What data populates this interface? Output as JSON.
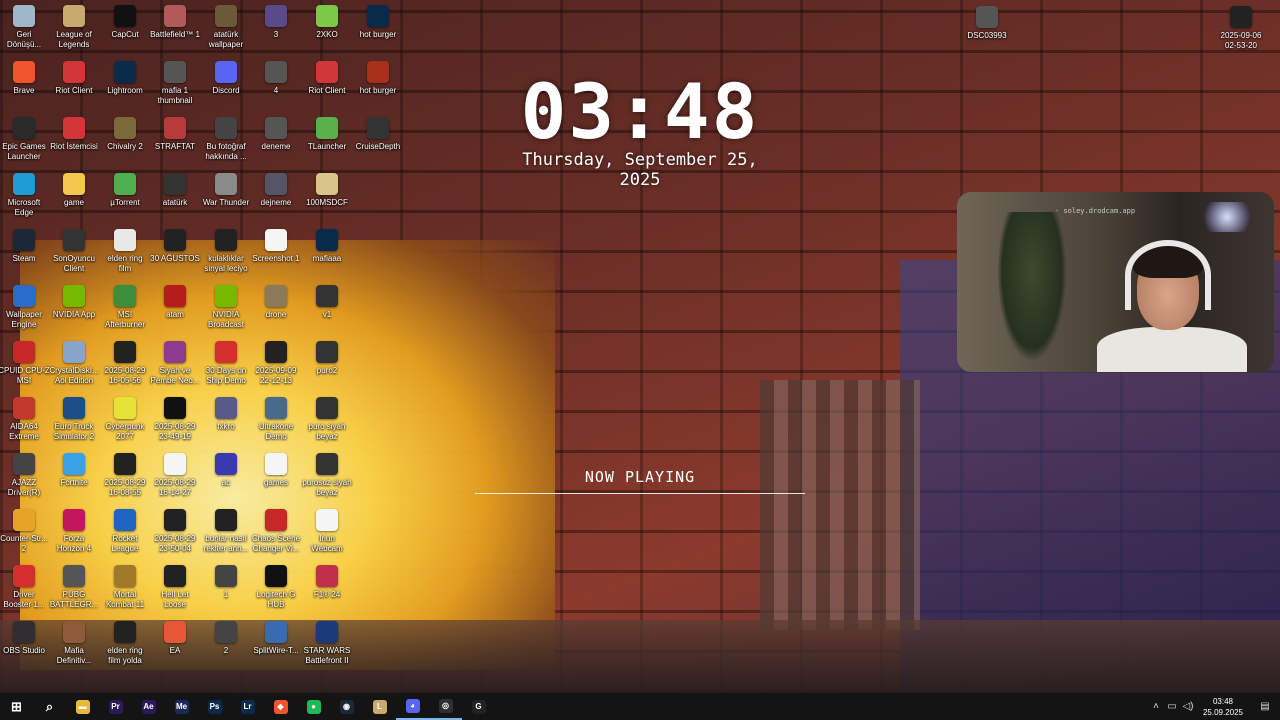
{
  "clock": {
    "time": "03:48",
    "date": "Thursday, September 25, 2025"
  },
  "now_playing": {
    "label": "NOW PLAYING"
  },
  "webcam": {
    "url_text": "· soley.drodcam.app"
  },
  "top_right_files": [
    {
      "label": "DSC03993"
    },
    {
      "label": "2025-09-06\n02-53-20"
    }
  ],
  "desktop_columns": [
    [
      {
        "label": "Geri\nDönüşü...",
        "icon": "recycle-bin-icon",
        "color": "#9fb7c9"
      },
      {
        "label": "Brave",
        "icon": "brave-icon",
        "color": "#f0542d"
      },
      {
        "label": "Epic Games\nLauncher",
        "icon": "epic-icon",
        "color": "#2a2a2a"
      },
      {
        "label": "Microsoft\nEdge",
        "icon": "edge-icon",
        "color": "#1f9bd6"
      },
      {
        "label": "Steam",
        "icon": "steam-icon",
        "color": "#1b2838"
      },
      {
        "label": "Wallpaper\nEngine",
        "icon": "wallpaper-engine-icon",
        "color": "#2a6cc9"
      },
      {
        "label": "CPUID CPU-Z\nMSI",
        "icon": "cpuz-icon",
        "color": "#c62828"
      },
      {
        "label": "AIDA64\nExtreme",
        "icon": "aida-icon",
        "color": "#c0392b"
      },
      {
        "label": "AJAZZ\nDriver(R)",
        "icon": "ajazz-icon",
        "color": "#444"
      },
      {
        "label": "Counter-Str...\n2",
        "icon": "cs2-icon",
        "color": "#e7a325"
      },
      {
        "label": "Driver\nBooster 1...",
        "icon": "driver-booster-icon",
        "color": "#d32f2f"
      },
      {
        "label": "OBS Studio",
        "icon": "obs-icon",
        "color": "#302e31"
      }
    ],
    [
      {
        "label": "League of\nLegends",
        "icon": "lol-icon",
        "color": "#c8aa6e"
      },
      {
        "label": "Riot Client",
        "icon": "riot-icon",
        "color": "#d13639"
      },
      {
        "label": "Riot İstemcisi",
        "icon": "riot-icon",
        "color": "#d13639"
      },
      {
        "label": "game",
        "icon": "folder-icon",
        "color": "#f3c74d"
      },
      {
        "label": "SonOyuncu\nClient",
        "icon": "sonoyuncu-icon",
        "color": "#333"
      },
      {
        "label": "NVIDIA App",
        "icon": "nvidia-icon",
        "color": "#76b900"
      },
      {
        "label": "CrystalDiskI...\nAoi Edition",
        "icon": "crystaldisk-icon",
        "color": "#8aa3c9"
      },
      {
        "label": "Euro Truck\nSimulator 2",
        "icon": "ets2-icon",
        "color": "#1d4e89"
      },
      {
        "label": "Fortnite",
        "icon": "fortnite-icon",
        "color": "#3aa0e8"
      },
      {
        "label": "Forza\nHorizon 4",
        "icon": "forza-icon",
        "color": "#c2185b"
      },
      {
        "label": "PUBG\nBATTLEGR...",
        "icon": "pubg-icon",
        "color": "#555"
      },
      {
        "label": "Mafia\nDefinitiv...",
        "icon": "mafia-icon",
        "color": "#8d5a3a"
      }
    ],
    [
      {
        "label": "CapCut",
        "icon": "capcut-icon",
        "color": "#111"
      },
      {
        "label": "Lightroom",
        "icon": "lightroom-icon",
        "color": "#0b2b4a"
      },
      {
        "label": "Chivalry 2",
        "icon": "chivalry-icon",
        "color": "#7a6a3a"
      },
      {
        "label": "µTorrent",
        "icon": "utorrent-icon",
        "color": "#4caf50"
      },
      {
        "label": "elden ring\nfilm",
        "icon": "document-icon",
        "color": "#e8e8e8"
      },
      {
        "label": "MSI\nAfterburner",
        "icon": "msi-icon",
        "color": "#3c8f3a"
      },
      {
        "label": "2025-08-29\n16-05-56",
        "icon": "video-file-icon",
        "color": "#222"
      },
      {
        "label": "Cyberpunk\n2077",
        "icon": "cyberpunk-icon",
        "color": "#e5e23a"
      },
      {
        "label": "2025-08-29\n16-08-55",
        "icon": "video-file-icon",
        "color": "#222"
      },
      {
        "label": "Rocket\nLeague",
        "icon": "rocket-league-icon",
        "color": "#2064c2"
      },
      {
        "label": "Mortal\nKombat 11",
        "icon": "mk-icon",
        "color": "#a07a2a"
      },
      {
        "label": "elden ring\nfilm yolda",
        "icon": "video-file-icon",
        "color": "#222"
      }
    ],
    [
      {
        "label": "Battlefield™ 1",
        "icon": "battlefield-icon",
        "color": "#b05a5a"
      },
      {
        "label": "mafia 1\nthumbnail",
        "icon": "image-file-icon",
        "color": "#555"
      },
      {
        "label": "STRAFTAT",
        "icon": "straftat-icon",
        "color": "#b83a3a"
      },
      {
        "label": "atatürk",
        "icon": "image-file-icon",
        "color": "#333"
      },
      {
        "label": "30 AĞUSTOS",
        "icon": "video-file-icon",
        "color": "#222"
      },
      {
        "label": "atam",
        "icon": "image-file-icon",
        "color": "#b71c1c"
      },
      {
        "label": "Siyah ve\nPembe Neo...",
        "icon": "image-file-icon",
        "color": "#8e3a8e"
      },
      {
        "label": "2025-08-29\n23-49-19",
        "icon": "video-file-icon",
        "color": "#111"
      },
      {
        "label": "2025-08-29\n16-14-27",
        "icon": "video-file-icon",
        "color": "#f5f5f5"
      },
      {
        "label": "2025-08-29\n23-50-04",
        "icon": "video-file-icon",
        "color": "#222"
      },
      {
        "label": "Hell Let\nLoose",
        "icon": "hll-icon",
        "color": "#222"
      },
      {
        "label": "EA",
        "icon": "ea-icon",
        "color": "#e8563a"
      }
    ],
    [
      {
        "label": "atatürk\nwallpaper",
        "icon": "image-file-icon",
        "color": "#6a5a3a"
      },
      {
        "label": "Discord",
        "icon": "discord-icon",
        "color": "#5865f2"
      },
      {
        "label": "Bu fotoğraf\nhakkında ...",
        "icon": "info-icon",
        "color": "#444"
      },
      {
        "label": "War Thunder",
        "icon": "war-thunder-icon",
        "color": "#8a8a8a"
      },
      {
        "label": "kulaklıklar\nsinyal leciyo",
        "icon": "video-file-icon",
        "color": "#222"
      },
      {
        "label": "NVIDIA\nBroadcast",
        "icon": "nvidia-broadcast-icon",
        "color": "#76b900"
      },
      {
        "label": "30 Days on\nShip Demo",
        "icon": "30days-icon",
        "color": "#d32f2f"
      },
      {
        "label": "fxkro",
        "icon": "image-file-icon",
        "color": "#5a5a8a"
      },
      {
        "label": "ac",
        "icon": "document-icon",
        "color": "#3a3ab0"
      },
      {
        "label": "bunlar nasıl\nreklter ann...",
        "icon": "video-file-icon",
        "color": "#222"
      },
      {
        "label": "1",
        "icon": "image-file-icon",
        "color": "#444"
      },
      {
        "label": "2",
        "icon": "image-file-icon",
        "color": "#444"
      }
    ],
    [
      {
        "label": "3",
        "icon": "image-file-icon",
        "color": "#5a4a8a"
      },
      {
        "label": "4",
        "icon": "image-file-icon",
        "color": "#555"
      },
      {
        "label": "deneme",
        "icon": "image-file-icon",
        "color": "#555"
      },
      {
        "label": "dejneme",
        "icon": "image-file-icon",
        "color": "#556"
      },
      {
        "label": "Screenshot 1",
        "icon": "document-icon",
        "color": "#f5f5f5"
      },
      {
        "label": "drone",
        "icon": "image-file-icon",
        "color": "#8a7a5a"
      },
      {
        "label": "2025-09-09\n22-12-13",
        "icon": "video-file-icon",
        "color": "#222"
      },
      {
        "label": "Ultrakone\nDemo",
        "icon": "ultrakone-icon",
        "color": "#4a6a8a"
      },
      {
        "label": "games",
        "icon": "document-icon",
        "color": "#f5f5f5"
      },
      {
        "label": "Chaos Scene\nChanger Vi...",
        "icon": "chaos-icon",
        "color": "#c62828"
      },
      {
        "label": "Logitech G\nHUB",
        "icon": "ghub-icon",
        "color": "#111"
      },
      {
        "label": "SplitWire-T...",
        "icon": "splitwire-icon",
        "color": "#3a6ab0"
      }
    ],
    [
      {
        "label": "2XKO",
        "icon": "2xko-icon",
        "color": "#7cc94a"
      },
      {
        "label": "Riot Client",
        "icon": "riot-icon",
        "color": "#d13639"
      },
      {
        "label": "TLauncher",
        "icon": "tlauncher-icon",
        "color": "#5ab04a"
      },
      {
        "label": "100MSDCF",
        "icon": "folder-icon",
        "color": "#d9c48a"
      },
      {
        "label": "mafiaaa",
        "icon": "photoshop-icon",
        "color": "#0a2a4a"
      },
      {
        "label": "v1",
        "icon": "image-file-icon",
        "color": "#333"
      },
      {
        "label": "puro2",
        "icon": "image-file-icon",
        "color": "#333"
      },
      {
        "label": "puro siyah\nbeyaz",
        "icon": "image-file-icon",
        "color": "#333"
      },
      {
        "label": "purosuz siyah\nbeyaz",
        "icon": "image-file-icon",
        "color": "#333"
      },
      {
        "label": "Iriun\nWebcam",
        "icon": "iriun-icon",
        "color": "#f5f5f5"
      },
      {
        "label": "F1® 24",
        "icon": "f1-icon",
        "color": "#c0304a"
      },
      {
        "label": "STAR WARS\nBattlefront II",
        "icon": "swbf-icon",
        "color": "#1a3a7a"
      }
    ],
    [
      {
        "label": "hot burger",
        "icon": "photoshop-icon",
        "color": "#0a2a4a"
      },
      {
        "label": "hot burger",
        "icon": "image-file-icon",
        "color": "#a8301a"
      },
      {
        "label": "CruiseDepth",
        "icon": "cruisedepth-icon",
        "color": "#333"
      }
    ]
  ],
  "taskbar": {
    "apps": [
      {
        "name": "start-icon",
        "glyph": "⊞",
        "color": "transparent"
      },
      {
        "name": "search-icon",
        "glyph": "⌕",
        "color": "transparent"
      },
      {
        "name": "file-explorer-icon",
        "glyph": "▬",
        "color": "#e8b93a"
      },
      {
        "name": "premiere-icon",
        "glyph": "Pr",
        "color": "#2a1a5a"
      },
      {
        "name": "after-effects-icon",
        "glyph": "Ae",
        "color": "#2a1a5a"
      },
      {
        "name": "media-encoder-icon",
        "glyph": "Me",
        "color": "#1a2a5a"
      },
      {
        "name": "photoshop-icon",
        "glyph": "Ps",
        "color": "#0a2a4a"
      },
      {
        "name": "lightroom-icon",
        "glyph": "Lr",
        "color": "#0b2b4a"
      },
      {
        "name": "brave-icon",
        "glyph": "◆",
        "color": "#f0542d"
      },
      {
        "name": "spotify-icon",
        "glyph": "●",
        "color": "#1db954"
      },
      {
        "name": "steam-icon",
        "glyph": "◉",
        "color": "#1b2838"
      },
      {
        "name": "league-icon",
        "glyph": "L",
        "color": "#c8aa6e"
      },
      {
        "name": "discord-icon",
        "glyph": "◕",
        "color": "#5865f2"
      },
      {
        "name": "obs-icon",
        "glyph": "◎",
        "color": "#302e31"
      },
      {
        "name": "ghub-icon",
        "glyph": "G",
        "color": "#222"
      }
    ],
    "tray": {
      "time": "03:48",
      "date": "25.09.2025"
    }
  }
}
